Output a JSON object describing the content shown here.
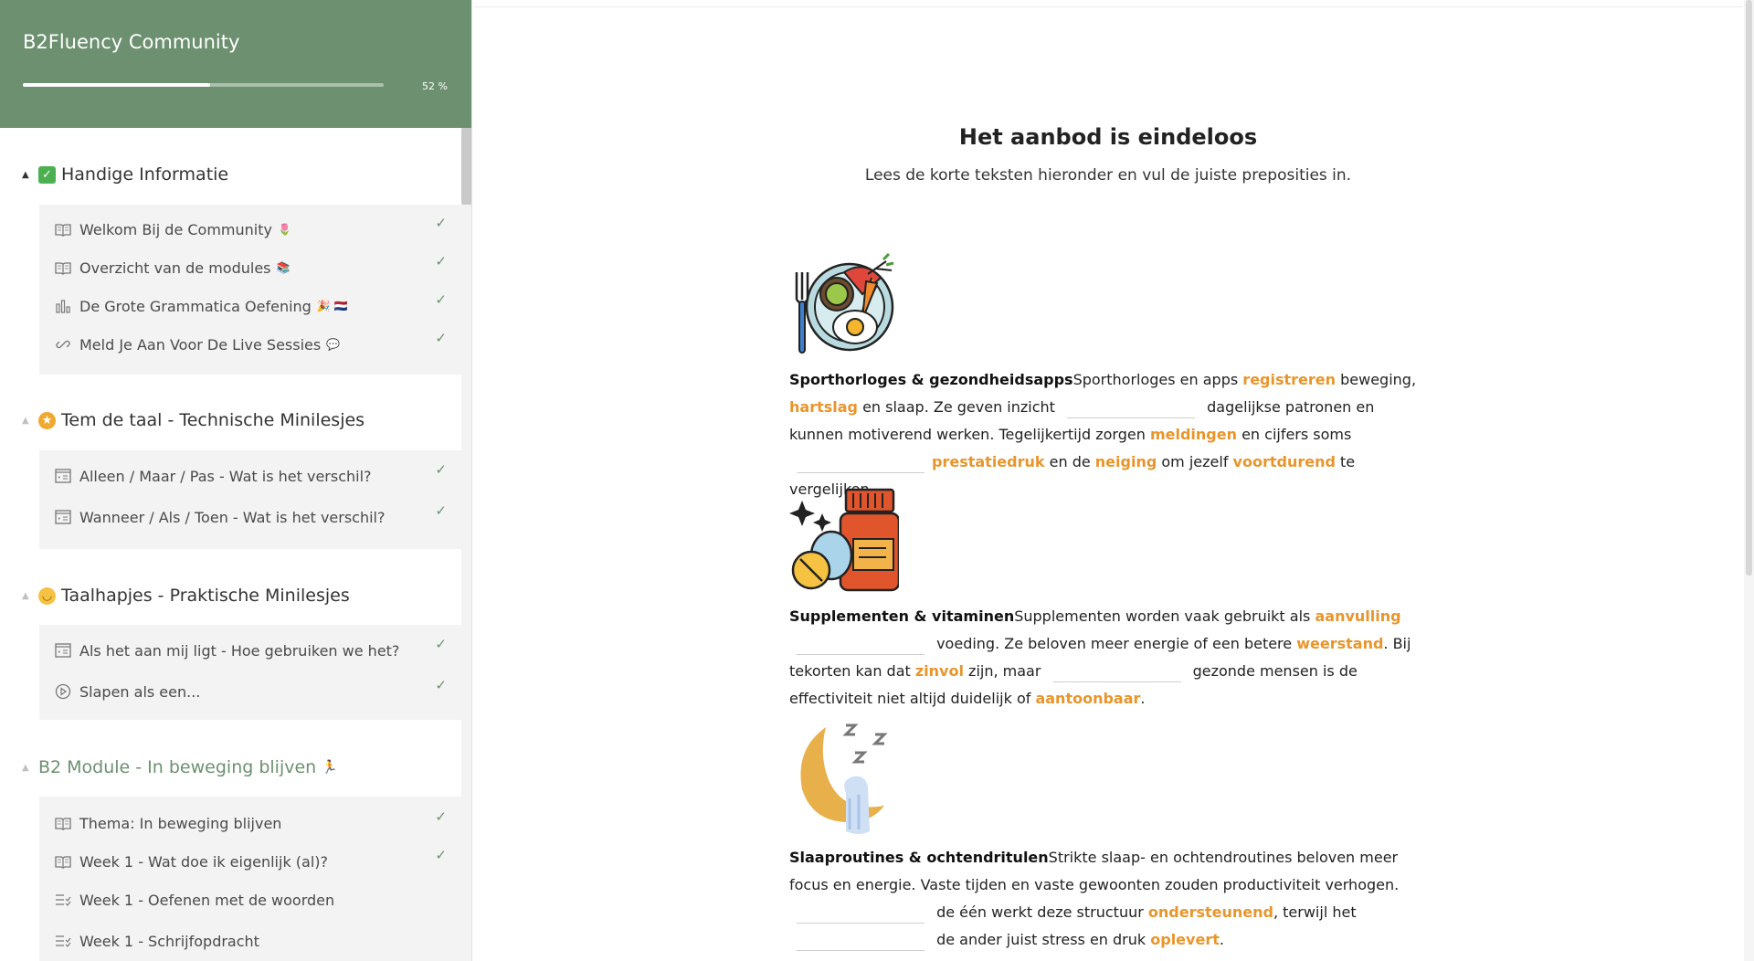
{
  "sidebar": {
    "title": "B2Fluency Community",
    "progress_percent": 52,
    "progress_label": "52 %",
    "sections": [
      {
        "title": "Handige Informatie",
        "icon": "check-box-emoji",
        "items": [
          {
            "label": "Welkom Bij de Community",
            "emoji": "🌷",
            "icon": "book-icon",
            "done": true
          },
          {
            "label": "Overzicht van de modules",
            "emoji": "📚",
            "icon": "book-icon",
            "done": true
          },
          {
            "label": "De Grote Grammatica Oefening",
            "emoji": "🎉 🇳🇱",
            "icon": "chart-icon",
            "done": true
          },
          {
            "label": "Meld Je Aan Voor De Live Sessies",
            "emoji": "💬",
            "icon": "link-icon",
            "done": true
          }
        ]
      },
      {
        "title": "Tem de taal - Technische Minilesjes",
        "icon": "star-struck-emoji",
        "items": [
          {
            "label": "Alleen / Maar / Pas - Wat is het verschil?",
            "icon": "slides-icon",
            "done": true
          },
          {
            "label": "Wanneer / Als / Toen - Wat is het verschil?",
            "icon": "slides-icon",
            "done": true
          }
        ]
      },
      {
        "title": "Taalhapjes - Praktische Minilesjes",
        "icon": "yum-emoji",
        "items": [
          {
            "label": "Als het aan mij ligt - Hoe gebruiken we het?",
            "icon": "slides-icon",
            "done": true
          },
          {
            "label": "Slapen als een...",
            "icon": "play-icon",
            "done": true
          }
        ]
      },
      {
        "title": "B2 Module - In beweging blijven",
        "emoji": "🏃",
        "items": [
          {
            "label": "Thema: In beweging blijven",
            "icon": "book-icon",
            "done": true
          },
          {
            "label": "Week 1 - Wat doe ik eigenlijk (al)?",
            "icon": "book-icon",
            "done": true
          },
          {
            "label": "Week 1 - Oefenen met de woorden",
            "icon": "checklist-icon",
            "done": false
          },
          {
            "label": "Week 1 - Schrijfopdracht",
            "icon": "checklist-icon",
            "done": false
          }
        ]
      }
    ],
    "check_mark": "✓"
  },
  "main": {
    "title": "Het aanbod is eindeloos",
    "subtitle": "Lees de korte teksten hieronder en vul de juiste preposities in.",
    "blocks": [
      {
        "heading": "Sporthorloges & gezondheidsapps",
        "t1": "Sporthorloges en apps ",
        "h1": "registreren",
        "t2": " beweging, ",
        "h2": "hartslag",
        "t3": " en slaap. Ze geven inzicht ",
        "t4": " dagelijkse patronen en kunnen motiverend werken. Tegelijkertijd zorgen ",
        "h3": "meldingen",
        "t5": " en cijfers soms ",
        "h4": "prestatiedruk",
        "t6": " en de ",
        "h5": "neiging",
        "t7": " om jezelf ",
        "h6": "voortdurend",
        "t8": " te vergelijken."
      },
      {
        "heading": "Supplementen & vitaminen",
        "t1": "Supplementen worden vaak gebruikt als ",
        "h1": "aanvulling",
        "t2": " voeding. Ze beloven meer energie of een betere ",
        "h2": "weerstand",
        "t3": ". Bij tekorten kan dat ",
        "h3": "zinvol",
        "t4": " zijn, maar ",
        "t5": " gezonde mensen is de effectiviteit niet altijd duidelijk of ",
        "h4": "aantoonbaar",
        "t6": "."
      },
      {
        "heading": "Slaaproutines & ochtendritulen",
        "t1": "Strikte slaap- en ochtendroutines beloven meer focus en energie. Vaste tijden en vaste gewoonten zouden productiviteit verhogen. ",
        "t2": " de één werkt deze structuur ",
        "h1": "ondersteunend",
        "t3": ", terwijl het ",
        "t4": " de ander juist stress en druk ",
        "h2": "oplevert",
        "t5": "."
      }
    ],
    "illustrations": [
      "food-plate-illustration",
      "supplements-illustration",
      "sleeping-moon-illustration"
    ]
  },
  "colors": {
    "brand_green": "#6c9070",
    "highlight_orange": "#e8952b",
    "sidebar_group_bg": "#f3f3f3"
  }
}
